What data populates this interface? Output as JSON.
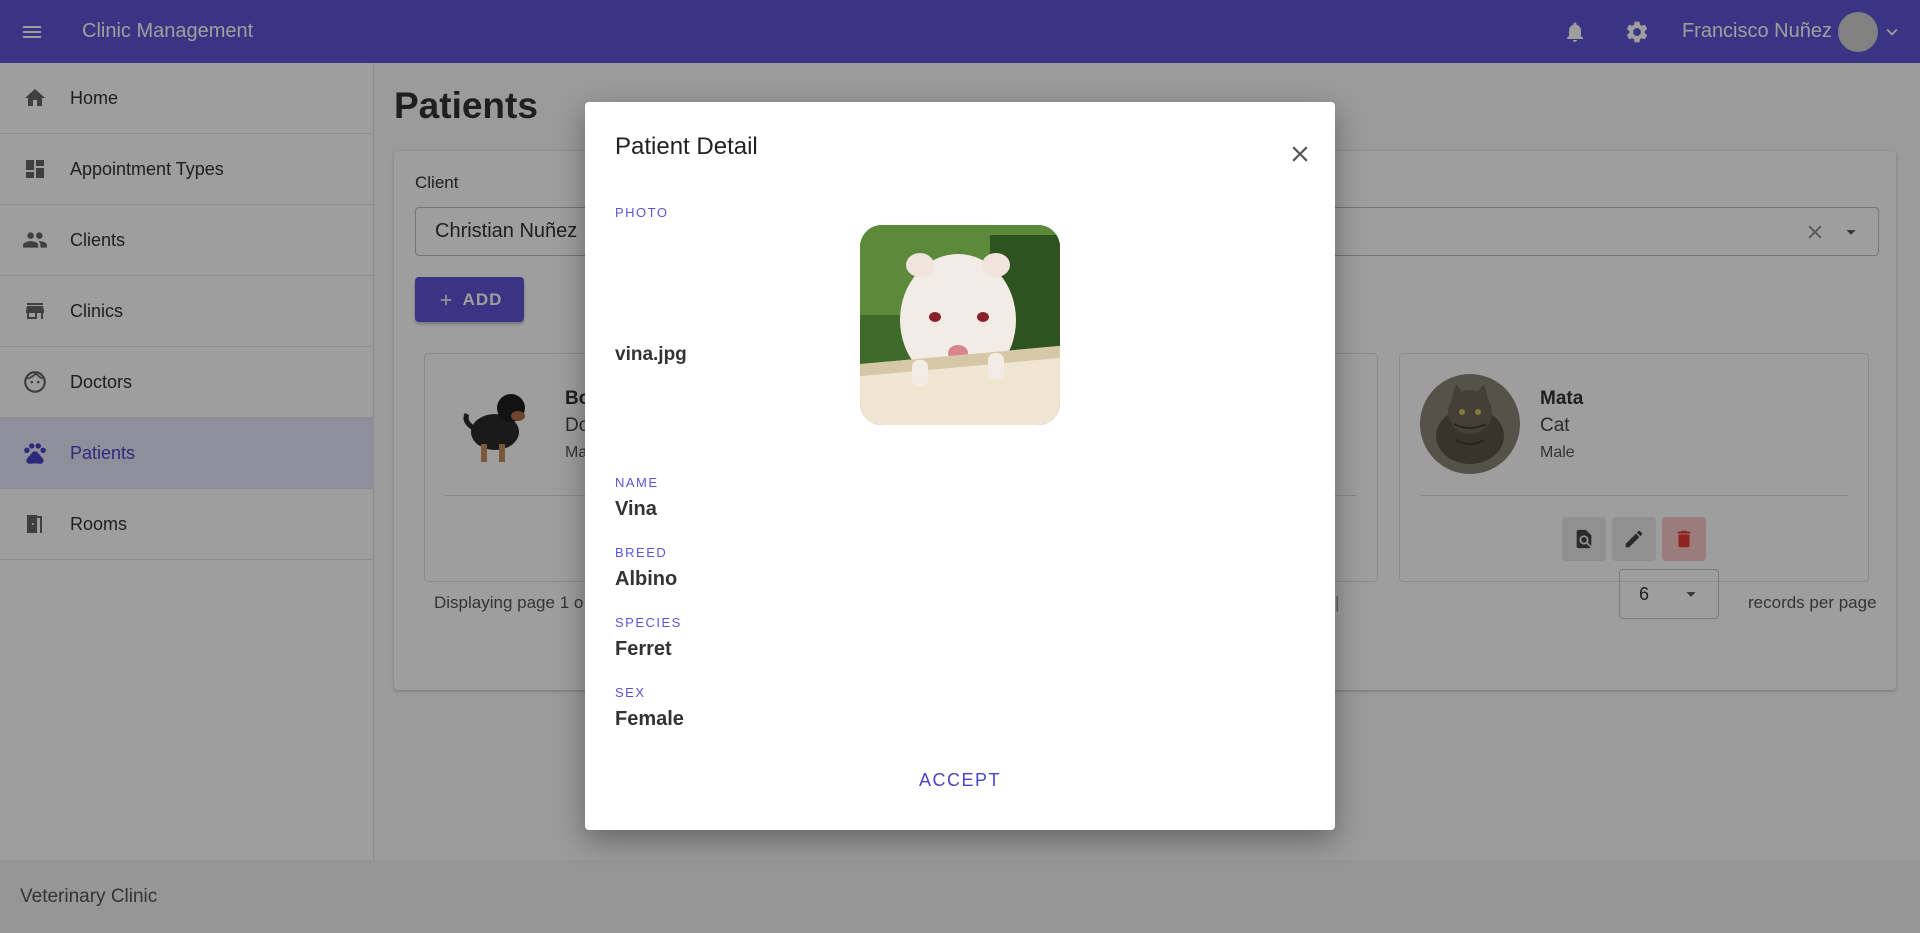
{
  "appbar": {
    "title": "Clinic Management",
    "user_name": "Francisco Nuñez",
    "color": "#5c56d6"
  },
  "sidebar": {
    "items": [
      {
        "label": "Home",
        "icon": "home-icon"
      },
      {
        "label": "Appointment Types",
        "icon": "dashboard-icon"
      },
      {
        "label": "Clients",
        "icon": "people-icon"
      },
      {
        "label": "Clinics",
        "icon": "store-icon"
      },
      {
        "label": "Doctors",
        "icon": "face-icon"
      },
      {
        "label": "Patients",
        "icon": "paw-icon",
        "active": true
      },
      {
        "label": "Rooms",
        "icon": "door-icon"
      }
    ]
  },
  "footer": {
    "text": "Veterinary Clinic"
  },
  "main": {
    "page_title": "Patients",
    "client_label": "Client",
    "client_value": "Christian Nuñez",
    "add_label": "ADD",
    "patients": [
      {
        "name": "Bo",
        "species": "Do",
        "sex": "Ma"
      },
      {
        "name": "Mata",
        "species": "Cat",
        "sex": "Male"
      }
    ],
    "paging_text": "Displaying page 1 o",
    "pager_separator": "|",
    "records_per_page": "6",
    "records_per_page_label": "records per page"
  },
  "dialog": {
    "title": "Patient Detail",
    "photo_caption": "PHOTO",
    "photo_filename": "vina.jpg",
    "name_caption": "NAME",
    "name": "Vina",
    "breed_caption": "BREED",
    "breed": "Albino",
    "species_caption": "SPECIES",
    "species": "Ferret",
    "sex_caption": "SEX",
    "sex": "Female",
    "accept_label": "ACCEPT"
  }
}
